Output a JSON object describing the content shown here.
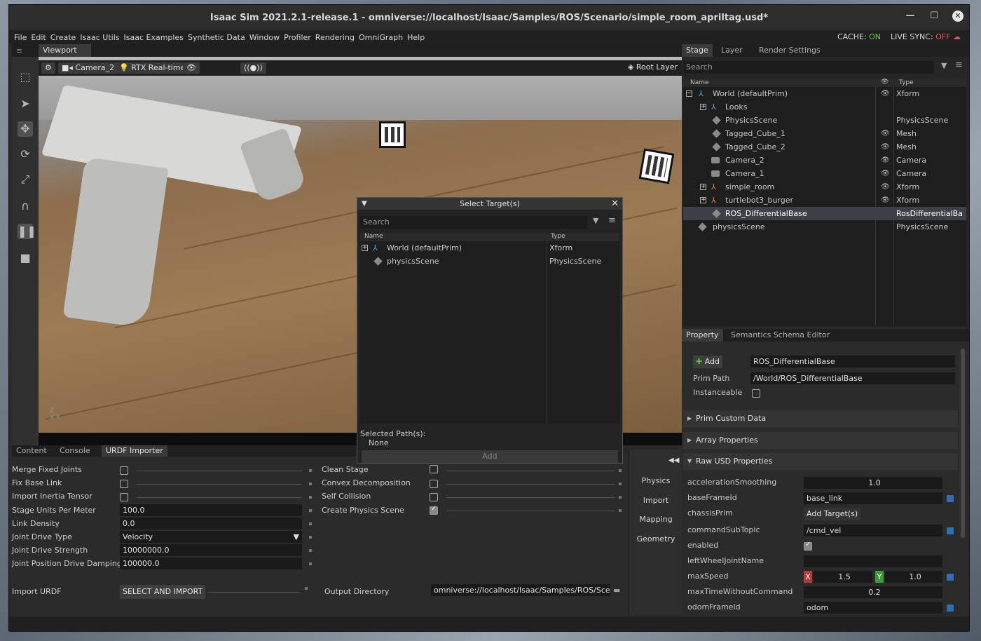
{
  "window": {
    "title": "Isaac Sim 2021.2.1-release.1 - omniverse://localhost/Isaac/Samples/ROS/Scenario/simple_room_apriltag.usd*",
    "minimize": "—",
    "maximize": "☐",
    "close": "✕"
  },
  "menu": {
    "items": [
      "File",
      "Edit",
      "Create",
      "Isaac Utils",
      "Isaac Examples",
      "Synthetic Data",
      "Window",
      "Profiler",
      "Rendering",
      "OmniGraph",
      "Help"
    ],
    "cache_label": "CACHE:",
    "cache_value": "ON",
    "live_sync_label": "LIVE SYNC:",
    "live_sync_value": "OFF"
  },
  "viewport": {
    "tab": "Viewport",
    "camera": "Camera_2",
    "renderer": "RTX Real-time",
    "root_layer": "Root Layer"
  },
  "select_target": {
    "title": "Select Target(s)",
    "search_placeholder": "Search",
    "col_name": "Name",
    "col_type": "Type",
    "rows": [
      {
        "name": "World (defaultPrim)",
        "type": "Xform"
      },
      {
        "name": "physicsScene",
        "type": "PhysicsScene"
      }
    ],
    "selected_label": "Selected Path(s):",
    "selected_value": "None",
    "add_label": "Add"
  },
  "bottom_tabs": [
    "Content",
    "Console",
    "URDF Importer"
  ],
  "urdf": {
    "merge_fixed_joints": "Merge Fixed Joints",
    "fix_base_link": "Fix Base Link",
    "import_inertia_tensor": "Import Inertia Tensor",
    "stage_units": "Stage Units Per Meter",
    "stage_units_value": "100.0",
    "link_density": "Link Density",
    "link_density_value": "0.0",
    "joint_drive_type": "Joint Drive Type",
    "joint_drive_type_value": "Velocity",
    "joint_drive_strength": "Joint Drive Strength",
    "joint_drive_strength_value": "10000000.0",
    "joint_position_damping": "Joint Position Drive Damping",
    "joint_position_damping_value": "100000.0",
    "clean_stage": "Clean Stage",
    "convex_decomposition": "Convex Decomposition",
    "self_collision": "Self Collision",
    "create_physics_scene": "Create Physics Scene",
    "import_urdf": "Import URDF",
    "select_and_import": "SELECT AND IMPORT",
    "output_directory": "Output Directory",
    "output_directory_value": "omniverse://localhost/Isaac/Samples/ROS/Scer"
  },
  "side_tabs": [
    "Physics",
    "Import",
    "Mapping",
    "Geometry"
  ],
  "stage": {
    "tabs": [
      "Stage",
      "Layer",
      "Render Settings"
    ],
    "search_placeholder": "Search",
    "col_name": "Name",
    "col_type": "Type",
    "rows": [
      {
        "name": "World (defaultPrim)",
        "type": "Xform"
      },
      {
        "name": "Looks",
        "type": ""
      },
      {
        "name": "PhysicsScene",
        "type": "PhysicsScene"
      },
      {
        "name": "Tagged_Cube_1",
        "type": "Mesh"
      },
      {
        "name": "Tagged_Cube_2",
        "type": "Mesh"
      },
      {
        "name": "Camera_2",
        "type": "Camera"
      },
      {
        "name": "Camera_1",
        "type": "Camera"
      },
      {
        "name": "simple_room",
        "type": "Xform"
      },
      {
        "name": "turtlebot3_burger",
        "type": "Xform"
      },
      {
        "name": "ROS_DifferentialBase",
        "type": "RosDifferentialBa"
      },
      {
        "name": "physicsScene",
        "type": "PhysicsScene"
      }
    ]
  },
  "property": {
    "tabs": [
      "Property",
      "Semantics Schema Editor"
    ],
    "add": "Add",
    "name_value": "ROS_DifferentialBase",
    "prim_path_label": "Prim Path",
    "prim_path_value": "/World/ROS_DifferentialBase",
    "instanceable_label": "Instanceable",
    "sections": [
      "Prim Custom Data",
      "Array Properties",
      "Raw USD Properties"
    ],
    "fields": {
      "acceleration_smoothing": "accelerationSmoothing",
      "acceleration_smoothing_value": "1.0",
      "base_frame_id": "baseFrameId",
      "base_frame_id_value": "base_link",
      "chassis_prim": "chassisPrim",
      "chassis_prim_value": "Add Target(s)",
      "command_sub_topic": "commandSubTopic",
      "command_sub_topic_value": "/cmd_vel",
      "enabled": "enabled",
      "left_wheel_joint_name": "leftWheelJointName",
      "max_speed": "maxSpeed",
      "max_speed_x": "1.5",
      "max_speed_y": "1.0",
      "max_time_without_command": "maxTimeWithoutCommand",
      "max_time_without_command_value": "0.2",
      "odom_frame_id": "odomFrameId",
      "odom_frame_id_value": "odom"
    }
  },
  "colors": {
    "accent_on": "#6ac84a",
    "accent_off": "#e05555",
    "selection": "#3c4047"
  }
}
